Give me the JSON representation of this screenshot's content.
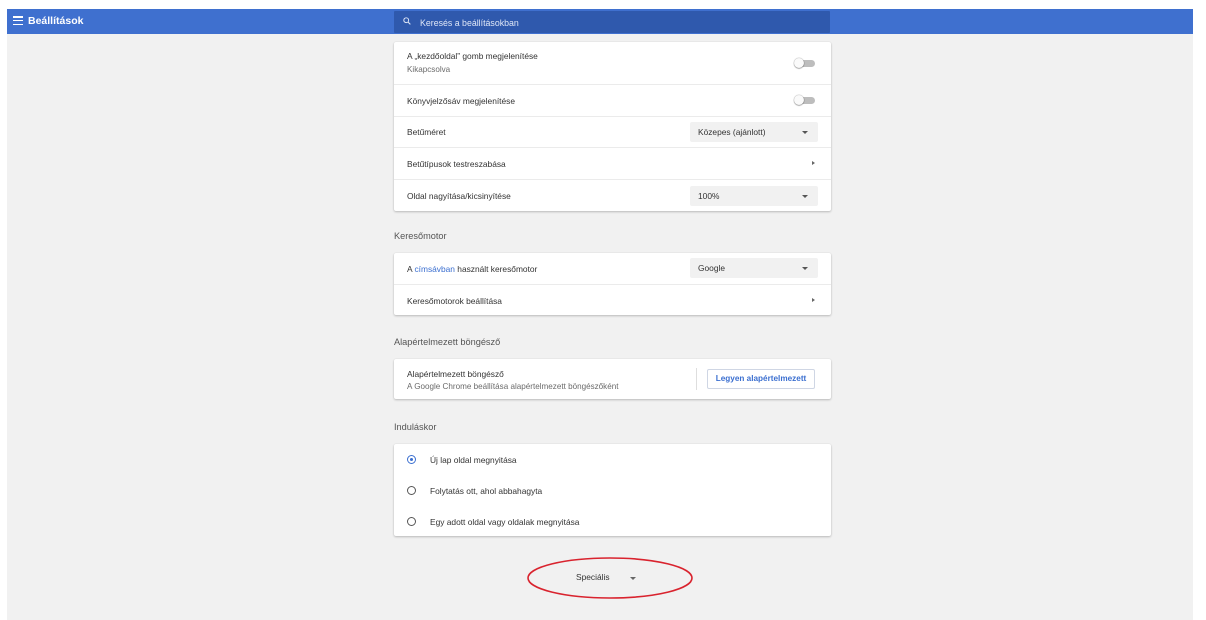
{
  "header": {
    "title": "Beállítások",
    "search_placeholder": "Keresés a beállításokban",
    "bar_color": "#3f70cf"
  },
  "appearance": {
    "home_button": {
      "label": "A „kezdőoldal” gomb megjelenítése",
      "sublabel": "Kikapcsolva",
      "enabled": false
    },
    "bookmarks_bar": {
      "label": "Könyvjelzősáv megjelenítése",
      "enabled": false
    },
    "font_size": {
      "label": "Betűméret",
      "value": "Közepes (ajánlott)"
    },
    "customize_fonts": {
      "label": "Betűtípusok testreszabása"
    },
    "page_zoom": {
      "label": "Oldal nagyítása/kicsinyítése",
      "value": "100%"
    }
  },
  "search_engine": {
    "section_title": "Keresőmotor",
    "engine_row": {
      "label_prefix": "A ",
      "label_link": "címsávban",
      "label_suffix": " használt keresőmotor",
      "value": "Google"
    },
    "manage_row": {
      "label": "Keresőmotorok beállítása"
    }
  },
  "default_browser": {
    "section_title": "Alapértelmezett böngésző",
    "label": "Alapértelmezett böngésző",
    "sublabel": "A Google Chrome beállítása alapértelmezett böngészőként",
    "button_label": "Legyen alapértelmezett"
  },
  "on_startup": {
    "section_title": "Induláskor",
    "options": [
      {
        "label": "Új lap oldal megnyitása",
        "selected": true
      },
      {
        "label": "Folytatás ott, ahol abbahagyta",
        "selected": false
      },
      {
        "label": "Egy adott oldal vagy oldalak megnyitása",
        "selected": false
      }
    ]
  },
  "advanced": {
    "label": "Speciális"
  },
  "colors": {
    "accent": "#3b6fd0",
    "annotation": "#d9232e"
  }
}
